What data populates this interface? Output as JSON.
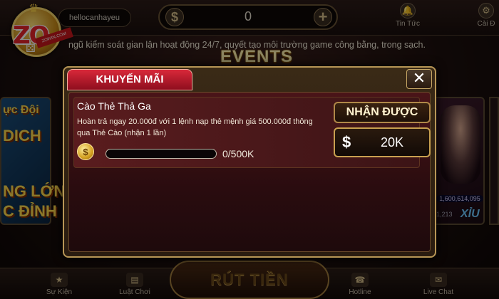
{
  "header": {
    "username": "hellocanhayeu",
    "balance": "0",
    "balance_icon": "$",
    "plus_icon": "+",
    "news_label": "Tin Tức",
    "settings_label": "Cài Đ"
  },
  "marquee": "ngũ kiểm soát gian lận hoạt động 24/7, quyết tạo môi trường game công bằng, trong sạch.",
  "logo": {
    "text": "ZO",
    "ribbon": "ZOWIN.COM"
  },
  "events_title": "EVENTS",
  "side_left": {
    "line1": "ực Đội",
    "line2": "DICH",
    "line3": "NG LỚN",
    "line4": "C ĐỈNH"
  },
  "side_right": {
    "jackpot": "1,600,614,095",
    "game": "XỈU",
    "count": "1,213"
  },
  "dialog": {
    "tab_label": "KHUYẾN MÃI",
    "close_label": "✕",
    "promo": {
      "title": "Cào Thẻ Thả Ga",
      "description": "Hoàn trả ngay 20.000đ với 1 lệnh nạp thẻ mệnh giá 500.000đ thông qua Thẻ Cào (nhận 1 lần)",
      "coin_symbol": "$",
      "progress_value": 0,
      "progress_max": 500,
      "progress_text": "0/500K",
      "reward_label": "NHẬN ĐƯỢC",
      "reward_currency": "$",
      "reward_amount": "20K"
    }
  },
  "bottom_nav": {
    "events": "Sự Kiện",
    "rules": "Luật Chơi",
    "withdraw": "RÚT TIỀN",
    "hotline": "Hotline",
    "livechat": "Live Chat"
  },
  "colors": {
    "tab_active": "#d8283a",
    "frame_gold": "#b79656",
    "panel_maroon": "#4a1418"
  }
}
